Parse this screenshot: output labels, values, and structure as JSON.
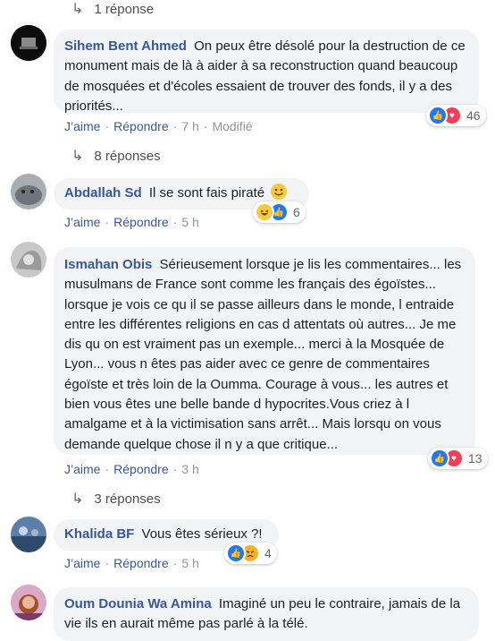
{
  "labels": {
    "like": "J’aime",
    "reply": "Répondre",
    "sep": "·"
  },
  "reply_links": [
    {
      "text": "1 réponse"
    },
    {
      "text": "8 réponses"
    },
    {
      "text": "3 réponses"
    }
  ],
  "comments": [
    {
      "author": "Sihem Bent Ahmed",
      "text": "On peux être désolé pour la destruction de ce monument mais de là à aider à sa reconstruction quand beaucoup de mosquées et d'écoles essaient de trouver des fonds, il y a des priorités...",
      "time": "7 h",
      "edited": "Modifié",
      "reaction_count": "46",
      "reaction_icons": [
        "like-icon",
        "love-icon"
      ]
    },
    {
      "author": "Abdallah Sd",
      "text": "Il se sont fais piraté",
      "emoji": "smile-emoji",
      "time": "5 h",
      "reaction_count": "6",
      "reaction_icons": [
        "haha-icon",
        "like-icon"
      ]
    },
    {
      "author": "Ismahan Obis",
      "text": "Sérieusement lorsque je lis les commentaires... les musulmans de France sont comme les français des égoïstes... lorsque je vois ce qu il se passe ailleurs dans le monde, l entraide entre les différentes religions en cas d attentats où autres... Je me dis qu on est vraiment pas un exemple... merci à la Mosquée de Lyon... vous n êtes pas aider avec ce genre de commentaires égoïste et très loin de la Oumma. Courage à vous... les autres et bien vous êtes une belle bande d hypocrites.Vous criez à l amalgame et à la victimisation sans arrêt... Mais lorsqu on vous demande quelque chose il n y a que critique...",
      "time": "3 h",
      "reaction_count": "13",
      "reaction_icons": [
        "like-icon",
        "love-icon"
      ]
    },
    {
      "author": "Khalida BF",
      "text": "Vous êtes sérieux ?!",
      "time": "5 h",
      "reaction_count": "4",
      "reaction_icons": [
        "like-icon",
        "angry-icon"
      ]
    },
    {
      "author": "Oum Dounia Wa Amina",
      "text": "Imaginé un peu le contraire, jamais de la vie ils en aurait même pas parlé à la télé."
    }
  ],
  "colors": {
    "link_blue": "#385898",
    "bubble_bg": "#f2f3f5",
    "meta_gray": "#90949c",
    "like_blue": "#2078f4",
    "love_red": "#f33e58",
    "haha_yellow": "#f7c843"
  }
}
